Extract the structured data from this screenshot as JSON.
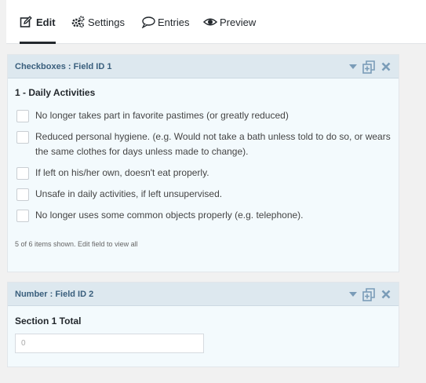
{
  "tabs": {
    "edit": "Edit",
    "settings": "Settings",
    "entries": "Entries",
    "preview": "Preview"
  },
  "field1": {
    "header_title": "Checkboxes : Field ID 1",
    "label": "1 - Daily Activities",
    "options": [
      "No longer takes part in favorite pastimes (or greatly reduced)",
      "Reduced personal hygiene. (e.g. Would not take a bath unless told to do so, or wears the same clothes for days unless made to change).",
      "If left on his/her own, doesn't eat properly.",
      "Unsafe in daily activities, if left unsupervised.",
      "No longer uses some common objects properly (e.g. telephone)."
    ],
    "footnote": "5 of 6 items shown. Edit field to view all"
  },
  "field2": {
    "header_title": "Number : Field ID 2",
    "label": "Section 1 Total",
    "input_value": "0"
  },
  "colors": {
    "panel_header_bg": "#dde8ef",
    "panel_body_bg": "#f3fafd",
    "header_title": "#3a5f7d",
    "icon": "#7a9cb8"
  },
  "icons": [
    "edit-icon",
    "gear-icon",
    "comment-icon",
    "eye-icon",
    "chevron-down-icon",
    "duplicate-icon",
    "close-icon"
  ]
}
